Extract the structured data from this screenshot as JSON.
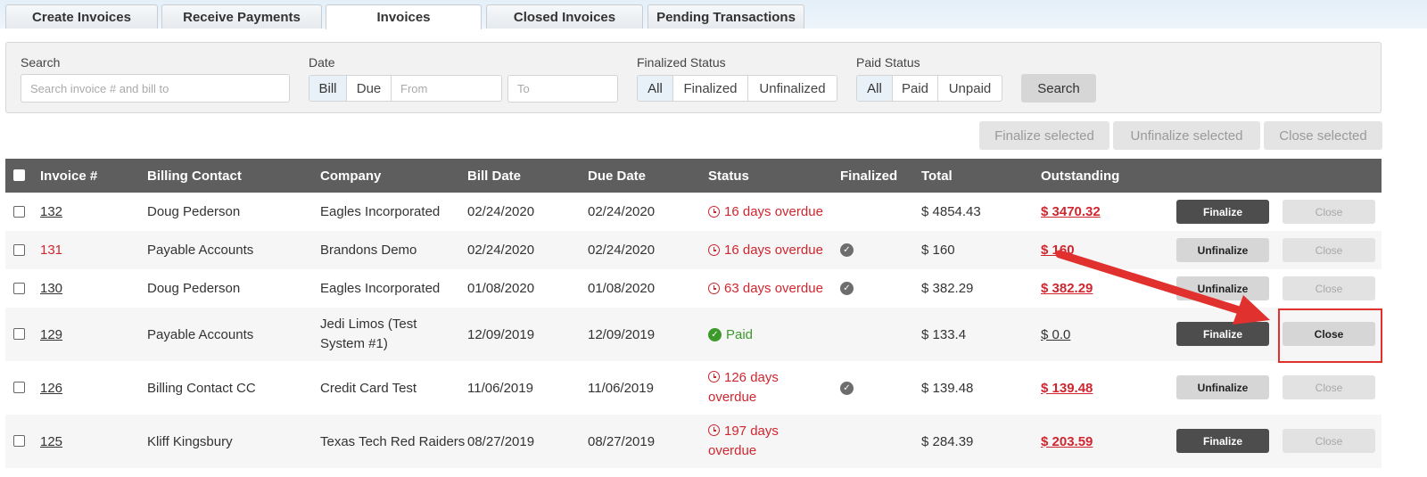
{
  "tabs": [
    {
      "label": "Create Invoices"
    },
    {
      "label": "Receive Payments"
    },
    {
      "label": "Invoices"
    },
    {
      "label": "Closed Invoices"
    },
    {
      "label": "Pending Transactions"
    }
  ],
  "filters": {
    "search_label": "Search",
    "search_placeholder": "Search invoice # and bill to",
    "date_label": "Date",
    "date_options": [
      "Bill",
      "Due"
    ],
    "from_placeholder": "From",
    "to_placeholder": "To",
    "finalized_label": "Finalized Status",
    "finalized_options": [
      "All",
      "Finalized",
      "Unfinalized"
    ],
    "paid_label": "Paid Status",
    "paid_options": [
      "All",
      "Paid",
      "Unpaid"
    ],
    "search_button": "Search"
  },
  "bulk_actions": {
    "finalize": "Finalize selected",
    "unfinalize": "Unfinalize selected",
    "close": "Close selected"
  },
  "columns": [
    "Invoice #",
    "Billing Contact",
    "Company",
    "Bill Date",
    "Due Date",
    "Status",
    "Finalized",
    "Total",
    "Outstanding"
  ],
  "rows": [
    {
      "invoice": "132",
      "contact": "Doug Pederson",
      "company": "Eagles Incorporated",
      "bill_date": "02/24/2020",
      "due_date": "02/24/2020",
      "status": "16 days overdue",
      "total": "$ 4854.43",
      "outstanding": "$ 3470.32",
      "action": "Finalize",
      "close": "Close"
    },
    {
      "invoice": "131",
      "contact": "Payable Accounts",
      "company": "Brandons Demo",
      "bill_date": "02/24/2020",
      "due_date": "02/24/2020",
      "status": "16 days overdue",
      "total": "$ 160",
      "outstanding": "$ 160",
      "action": "Unfinalize",
      "close": "Close"
    },
    {
      "invoice": "130",
      "contact": "Doug Pederson",
      "company": "Eagles Incorporated",
      "bill_date": "01/08/2020",
      "due_date": "01/08/2020",
      "status": "63 days overdue",
      "total": "$ 382.29",
      "outstanding": "$ 382.29",
      "action": "Unfinalize",
      "close": "Close"
    },
    {
      "invoice": "129",
      "contact": "Payable Accounts",
      "company_line1": "Jedi Limos (Test",
      "company_line2": "System #1)",
      "bill_date": "12/09/2019",
      "due_date": "12/09/2019",
      "status": "Paid",
      "total": "$ 133.4",
      "outstanding": "$ 0.0",
      "action": "Finalize",
      "close": "Close"
    },
    {
      "invoice": "126",
      "contact": "Billing Contact CC",
      "company": "Credit Card Test",
      "bill_date": "11/06/2019",
      "due_date": "11/06/2019",
      "status_line1": "126 days",
      "status_line2": "overdue",
      "total": "$ 139.48",
      "outstanding": "$ 139.48",
      "action": "Unfinalize",
      "close": "Close"
    },
    {
      "invoice": "125",
      "contact": "Kliff Kingsbury",
      "company": "Texas Tech Red Raiders",
      "bill_date": "08/27/2019",
      "due_date": "08/27/2019",
      "status_line1": "197 days",
      "status_line2": "overdue",
      "total": "$ 284.39",
      "outstanding": "$ 203.59",
      "action": "Finalize",
      "close": "Close"
    }
  ],
  "colors": {
    "overdue": "#d0262f",
    "paid": "#3c9a2b",
    "header_bg": "#5e5e5e",
    "annotation": "#e0312f"
  },
  "icons": {
    "overdue": "clock-icon",
    "paid": "check-circle-icon",
    "finalized": "check-circle-icon"
  }
}
